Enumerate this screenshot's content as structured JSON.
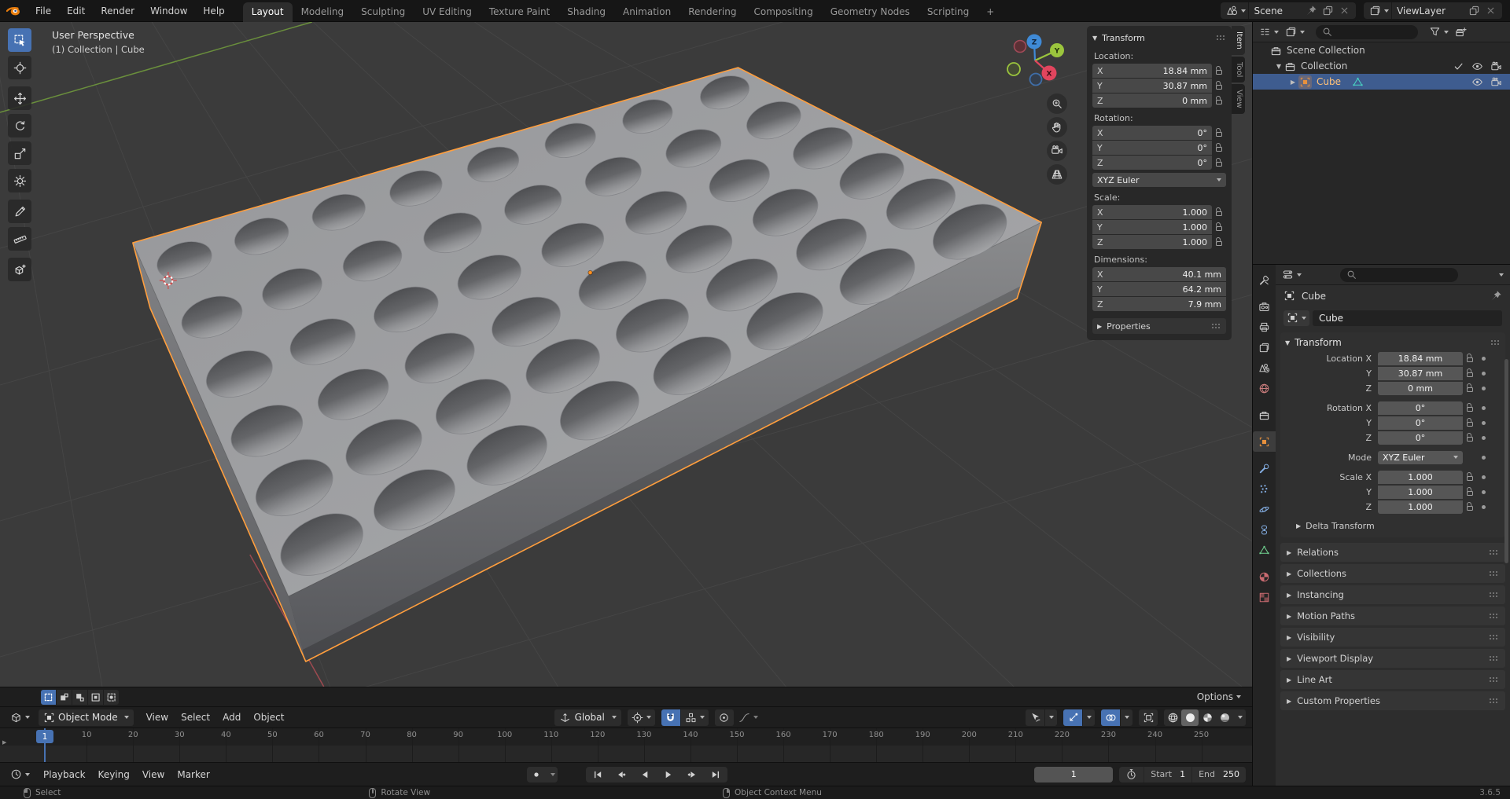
{
  "colors": {
    "accent": "#4772b3",
    "selection_outline": "#ff9e3d",
    "viewport_bg": "#3b3b3b",
    "grid": "#454545",
    "axis_x": "#9e4a50",
    "axis_y": "#6a8f3c",
    "gizmo_x": "#e2455e",
    "gizmo_y": "#9bc53d",
    "gizmo_z": "#3f8ad6",
    "object_icon": "#e8913d",
    "mesh_icon": "#49d4c3",
    "outliner_selected_bg": "#3e5c8f",
    "active_object_text": "#ffc178"
  },
  "topbar": {
    "menus": [
      "File",
      "Edit",
      "Render",
      "Window",
      "Help"
    ],
    "tabs": [
      {
        "label": "Layout",
        "active": true
      },
      {
        "label": "Modeling"
      },
      {
        "label": "Sculpting"
      },
      {
        "label": "UV Editing"
      },
      {
        "label": "Texture Paint"
      },
      {
        "label": "Shading"
      },
      {
        "label": "Animation"
      },
      {
        "label": "Rendering"
      },
      {
        "label": "Compositing"
      },
      {
        "label": "Geometry Nodes"
      },
      {
        "label": "Scripting"
      }
    ],
    "add_tab": "+",
    "scene_name": "Scene",
    "viewlayer_name": "ViewLayer"
  },
  "viewport": {
    "view_label": "User Perspective",
    "context_label": "(1) Collection | Cube",
    "tools": [
      {
        "name": "select-box",
        "active": true
      },
      {
        "name": "cursor"
      },
      {
        "name": "move",
        "gap": true
      },
      {
        "name": "rotate"
      },
      {
        "name": "scale"
      },
      {
        "name": "transform"
      },
      {
        "name": "annotate",
        "gap": true
      },
      {
        "name": "measure"
      },
      {
        "name": "add-cube",
        "gap": true
      }
    ],
    "gizmo_axes": {
      "x": "X",
      "y": "Y",
      "z": "Z"
    },
    "options_label": "Options",
    "header": {
      "mode": "Object Mode",
      "menus": [
        "View",
        "Select",
        "Add",
        "Object"
      ],
      "orientation": "Global"
    }
  },
  "npanel": {
    "title": "Transform",
    "tabs": [
      {
        "label": "Item",
        "active": true
      },
      {
        "label": "Tool"
      },
      {
        "label": "View"
      }
    ],
    "groups": [
      {
        "label": "Location:",
        "locks": true,
        "rows": [
          {
            "axis": "X",
            "value": "18.84 mm"
          },
          {
            "axis": "Y",
            "value": "30.87 mm"
          },
          {
            "axis": "Z",
            "value": "0 mm"
          }
        ]
      },
      {
        "label": "Rotation:",
        "locks": true,
        "dropdown": "XYZ Euler",
        "rows": [
          {
            "axis": "X",
            "value": "0°"
          },
          {
            "axis": "Y",
            "value": "0°"
          },
          {
            "axis": "Z",
            "value": "0°"
          }
        ]
      },
      {
        "label": "Scale:",
        "locks": true,
        "rows": [
          {
            "axis": "X",
            "value": "1.000"
          },
          {
            "axis": "Y",
            "value": "1.000"
          },
          {
            "axis": "Z",
            "value": "1.000"
          }
        ]
      },
      {
        "label": "Dimensions:",
        "locks": false,
        "rows": [
          {
            "axis": "X",
            "value": "40.1 mm"
          },
          {
            "axis": "Y",
            "value": "64.2 mm"
          },
          {
            "axis": "Z",
            "value": "7.9 mm"
          }
        ]
      }
    ],
    "collapsed_panel": "Properties"
  },
  "outliner": {
    "rows": [
      {
        "label": "Scene Collection",
        "icon": "collection",
        "level": 0,
        "toggles": []
      },
      {
        "label": "Collection",
        "icon": "collection",
        "level": 1,
        "disclosure": "down",
        "toggles": [
          "checkbox",
          "eye",
          "camera"
        ]
      },
      {
        "label": "Cube",
        "icon": "object",
        "data_icon": "mesh",
        "level": 2,
        "disclosure": "right",
        "selected": true,
        "toggles": [
          "eye",
          "camera"
        ]
      }
    ]
  },
  "properties": {
    "tabs": [
      {
        "name": "tool"
      },
      {
        "name": "render",
        "group": true
      },
      {
        "name": "output"
      },
      {
        "name": "view-layer"
      },
      {
        "name": "scene"
      },
      {
        "name": "world"
      },
      {
        "name": "collection",
        "group": true
      },
      {
        "name": "object",
        "group": true,
        "active": true
      },
      {
        "name": "modifiers",
        "group": true
      },
      {
        "name": "particles"
      },
      {
        "name": "physics"
      },
      {
        "name": "constraints"
      },
      {
        "name": "object-data"
      },
      {
        "name": "material",
        "group": true
      },
      {
        "name": "texture"
      }
    ],
    "breadcrumb": "Cube",
    "name_value": "Cube",
    "transform_title": "Transform",
    "rows": [
      {
        "label": "Location X",
        "value": "18.84 mm",
        "lock": true
      },
      {
        "label": "Y",
        "value": "30.87 mm",
        "lock": true
      },
      {
        "label": "Z",
        "value": "0 mm",
        "lock": true
      },
      {
        "label": "Rotation X",
        "value": "0°",
        "lock": true,
        "gap": true
      },
      {
        "label": "Y",
        "value": "0°",
        "lock": true
      },
      {
        "label": "Z",
        "value": "0°",
        "lock": true
      },
      {
        "label": "Mode",
        "value": "XYZ Euler",
        "dropdown": true,
        "gap": true
      },
      {
        "label": "Scale X",
        "value": "1.000",
        "lock": true,
        "gap": true
      },
      {
        "label": "Y",
        "value": "1.000",
        "lock": true
      },
      {
        "label": "Z",
        "value": "1.000",
        "lock": true
      }
    ],
    "sub_panel": "Delta Transform",
    "collapsed_panels": [
      "Relations",
      "Collections",
      "Instancing",
      "Motion Paths",
      "Visibility",
      "Viewport Display",
      "Line Art",
      "Custom Properties"
    ]
  },
  "timeline": {
    "menus": [
      "Playback",
      "Keying",
      "View",
      "Marker"
    ],
    "ticks": [
      10,
      20,
      30,
      40,
      50,
      60,
      70,
      80,
      90,
      100,
      110,
      120,
      130,
      140,
      150,
      160,
      170,
      180,
      190,
      200,
      210,
      220,
      230,
      240,
      250
    ],
    "current_frame": "1",
    "frame_field": "1",
    "start_label": "Start",
    "start_value": "1",
    "end_label": "End",
    "end_value": "250"
  },
  "statusbar": {
    "items": [
      {
        "icon": "mouse-left",
        "label": "Select"
      },
      {
        "icon": "mouse-middle",
        "label": "Rotate View"
      },
      {
        "icon": "mouse-right",
        "label": "Object Context Menu"
      }
    ],
    "version": "3.6.5"
  },
  "scene3d": {
    "object": "Cube",
    "hole_cols": 8,
    "hole_rows": 6
  }
}
